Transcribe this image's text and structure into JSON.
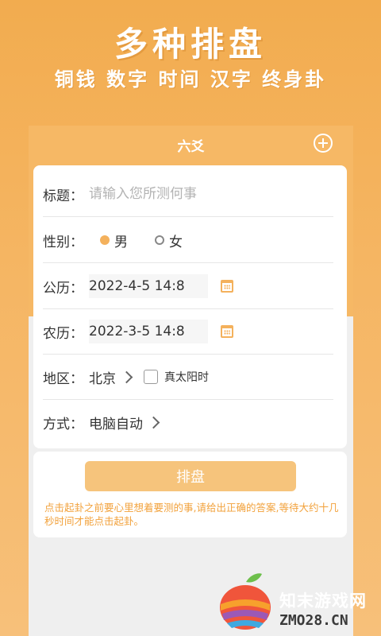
{
  "hero": {
    "title": "多种排盘",
    "subtitle": "铜钱 数字 时间 汉字 终身卦"
  },
  "header": {
    "title": "六爻",
    "add_icon": "plus-circle-icon"
  },
  "form": {
    "title_label": "标题：",
    "title_placeholder": "请输入您所测何事",
    "gender_label": "性别：",
    "gender_options": [
      "男",
      "女"
    ],
    "gender_selected": "男",
    "solar_label": "公历：",
    "solar_value": "2022-4-5 14:8",
    "lunar_label": "农历：",
    "lunar_value": "2022-3-5 14:8",
    "region_label": "地区：",
    "region_value": "北京",
    "true_solar_label": "真太阳时",
    "method_label": "方式：",
    "method_value": "电脑自动"
  },
  "action": {
    "submit_label": "排盘",
    "hint": "点击起卦之前要心里想着要测的事,请给出正确的答案,等待大约十几秒时间才能点击起卦。"
  },
  "watermark": {
    "name": "知末游戏网",
    "url": "ZMO28.CN"
  },
  "colors": {
    "accent": "#f4b15c",
    "hint": "#f2a23c",
    "button": "#f6c47c"
  }
}
